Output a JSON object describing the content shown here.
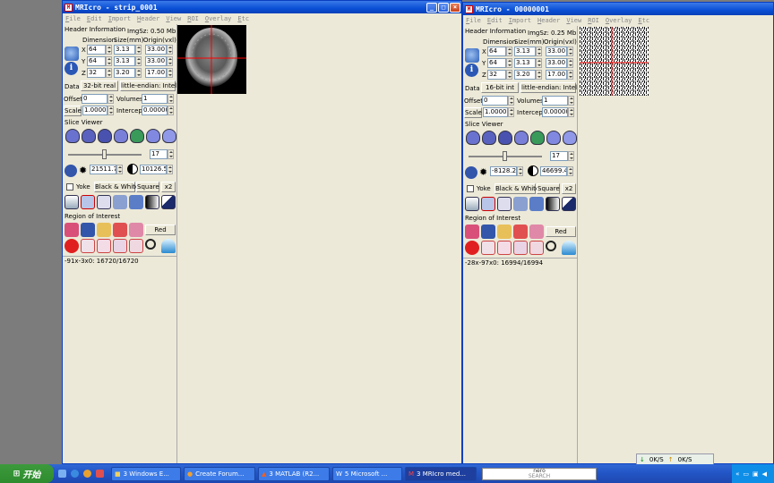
{
  "taskbar": {
    "start_label": "开始",
    "tasks": [
      "3 Windows E...",
      "Create Forum...",
      "3 MATLAB (R2...",
      "5 Microsoft ...",
      "3 MRIcro med..."
    ],
    "nero_label": "nero",
    "nero_sub": "SEARCH",
    "clock": ""
  },
  "net_monitor": {
    "down": "0K/S",
    "up": "0K/S"
  },
  "win1": {
    "title": "MRIcro - strip_0001",
    "menu": [
      "File",
      "Edit",
      "Import",
      "Header",
      "View",
      "ROI",
      "Overlay",
      "Etc"
    ],
    "header_info": "Header Information",
    "imgsz": "ImgSz: 0.50 Mb",
    "col_dim": "Dimension",
    "col_size": "Size(mm)",
    "col_origin": "Origin(vxl)",
    "rows": [
      {
        "axis": "X",
        "dim": "64",
        "size": "3.13",
        "origin": "33.00"
      },
      {
        "axis": "Y",
        "dim": "64",
        "size": "3.13",
        "origin": "33.00"
      },
      {
        "axis": "Z",
        "dim": "32",
        "size": "3.20",
        "origin": "17.00"
      }
    ],
    "data_label": "Data",
    "datatype": "32-bit real",
    "endian": "little-endian: Intel",
    "offset_label": "Offset",
    "offset_value": "0",
    "volumes_label": "Volumes",
    "volumes_value": "1",
    "scale_label": "Scale",
    "scale_value": "1.000000",
    "intercept_label": "Intercept",
    "intercept_value": "0.000000",
    "slice_viewer": "Slice Viewer",
    "slice_value": "17",
    "min_value": "21511.75",
    "max_value": "10126.50",
    "yoke": "Yoke",
    "colorscheme": "Black & White",
    "square": "Square",
    "zoom": "x2",
    "roi_label": "Region of Interest",
    "roi_color": "Red",
    "status": "-91x-3x0: 16720/16720"
  },
  "win2": {
    "title": "MRIcro - 00000001",
    "menu": [
      "File",
      "Edit",
      "Import",
      "Header",
      "View",
      "ROI",
      "Overlay",
      "Etc"
    ],
    "header_info": "Header Information",
    "imgsz": "ImgSz: 0.25 Mb",
    "col_dim": "Dimension",
    "col_size": "Size(mm)",
    "col_origin": "Origin(vxl)",
    "rows": [
      {
        "axis": "X",
        "dim": "64",
        "size": "3.13",
        "origin": "33.00"
      },
      {
        "axis": "Y",
        "dim": "64",
        "size": "3.13",
        "origin": "33.00"
      },
      {
        "axis": "Z",
        "dim": "32",
        "size": "3.20",
        "origin": "17.00"
      }
    ],
    "data_label": "Data",
    "datatype": "16-bit int",
    "endian": "little-endian: Intel",
    "offset_label": "Offset",
    "offset_value": "0",
    "volumes_label": "Volumes",
    "volumes_value": "1",
    "scale_label": "Scale",
    "scale_value": "1.000000",
    "intercept_label": "Intercept",
    "intercept_value": "0.000000",
    "slice_viewer": "Slice Viewer",
    "slice_value": "17",
    "min_value": "-8128.24",
    "max_value": "46699.42",
    "yoke": "Yoke",
    "colorscheme": "Black & White",
    "square": "Square",
    "zoom": "x2",
    "roi_label": "Region of Interest",
    "roi_color": "Red",
    "status": "-28x-97x0: 16994/16994"
  },
  "colors": {
    "titlebar": "#0a4fd6",
    "crosshair": "#ff0000",
    "workspace": "#7c7c7c",
    "panel": "#ece9d8"
  }
}
